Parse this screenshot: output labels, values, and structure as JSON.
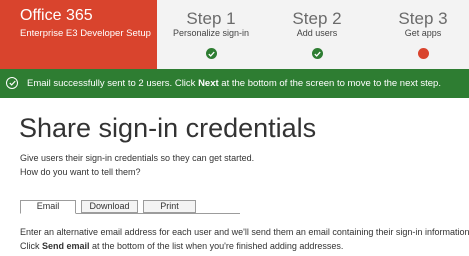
{
  "brand": {
    "product": "Office 365",
    "plan": "Enterprise E3 Developer Setup",
    "color": "#d9442d"
  },
  "steps": [
    {
      "number": "Step 1",
      "label": "Personalize sign-in",
      "status": "complete",
      "icon": "checkmark-icon",
      "color": "#2e7d32"
    },
    {
      "number": "Step 2",
      "label": "Add users",
      "status": "complete",
      "icon": "checkmark-icon",
      "color": "#2e7d32"
    },
    {
      "number": "Step 3",
      "label": "Get apps",
      "status": "current",
      "icon": "red-dot-icon",
      "color": "#d9442d"
    }
  ],
  "banner": {
    "icon": "success-check-icon",
    "text_before": "Email successfully sent to 2 users. Click ",
    "text_bold": "Next",
    "text_after": " at the bottom of the screen to move to the next step.",
    "color": "#2e7d32"
  },
  "main": {
    "title": "Share sign-in credentials",
    "line1": "Give users their sign-in credentials so they can get started.",
    "line2": "How do you want to tell them?",
    "tabs": [
      {
        "label": "Email",
        "active": true
      },
      {
        "label": "Download",
        "active": false
      },
      {
        "label": "Print",
        "active": false
      }
    ],
    "instruction1": "Enter an alternative email address for each user and we'll send them an email containing their sign-in information.",
    "instruction2_before": "Click ",
    "instruction2_bold": "Send email",
    "instruction2_after": " at the bottom of the list when you're finished adding addresses."
  }
}
